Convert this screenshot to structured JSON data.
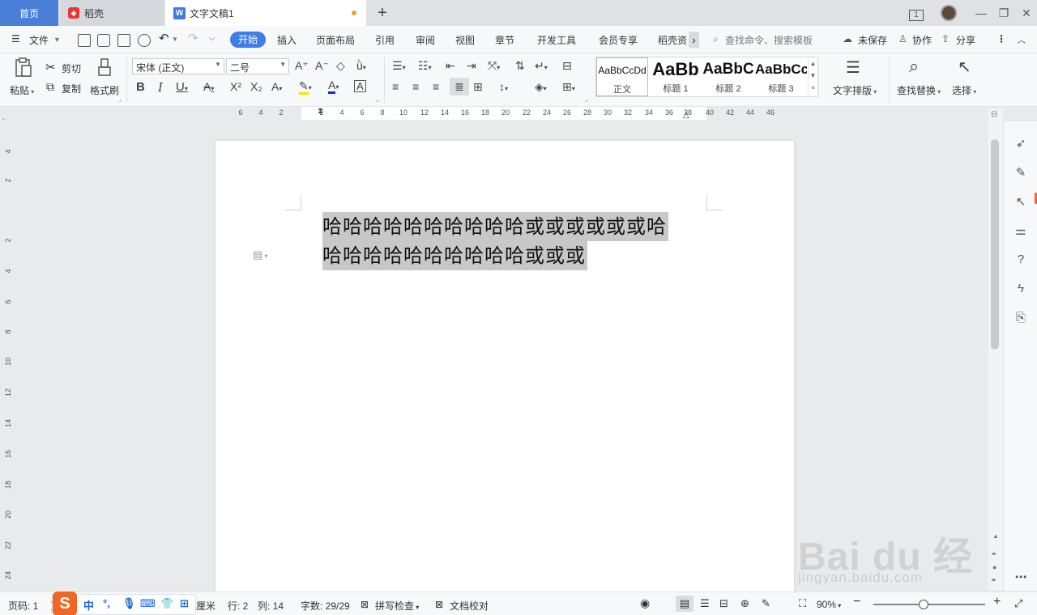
{
  "window": {
    "tabs": [
      {
        "label": "首页"
      },
      {
        "label": "稻壳"
      },
      {
        "label": "文字文稿1"
      }
    ],
    "add_tab": "+",
    "page_count_badge": "1"
  },
  "menu": {
    "file": "文件",
    "items": [
      "开始",
      "插入",
      "页面布局",
      "引用",
      "审阅",
      "视图",
      "章节",
      "开发工具",
      "会员专享",
      "稻壳资"
    ],
    "more": "›",
    "search_placeholder": "查找命令、搜索模板",
    "unsaved": "未保存",
    "collab": "协作",
    "share": "分享"
  },
  "ribbon": {
    "paste": "粘贴",
    "cut": "剪切",
    "copy": "复制",
    "format_painter": "格式刷",
    "font_name": "宋体 (正文)",
    "font_size": "二号",
    "styles": [
      {
        "preview": "AaBbCcDd",
        "label": "正文"
      },
      {
        "preview": "AaBb",
        "label": "标题 1"
      },
      {
        "preview": "AaBbC",
        "label": "标题 2"
      },
      {
        "preview": "AaBbCc",
        "label": "标题 3"
      }
    ],
    "text_layout": "文字排版",
    "find_replace": "查找替换",
    "select": "选择"
  },
  "ruler": {
    "h_marks": [
      "6",
      "4",
      "2",
      "2",
      "4",
      "6",
      "8",
      "10",
      "12",
      "14",
      "16",
      "18",
      "20",
      "22",
      "24",
      "26",
      "28",
      "30",
      "32",
      "34",
      "36",
      "38",
      "40",
      "42",
      "44",
      "46"
    ],
    "v_marks": [
      "4",
      "2",
      "2",
      "4",
      "6",
      "8",
      "10",
      "12",
      "14",
      "16",
      "18",
      "20",
      "22",
      "24"
    ]
  },
  "document": {
    "lines": [
      "哈哈哈哈哈哈哈哈哈哈或或或或或或哈",
      "哈哈哈哈哈哈哈哈哈哈或或或"
    ]
  },
  "status": {
    "page": "页码: 1",
    "page_cont": "页",
    "unit": "厘米",
    "row": "行: 2",
    "col": "列: 14",
    "word_count": "字数: 29/29",
    "spell_check": "拼写检查",
    "doc_proof": "文档校对",
    "zoom": "90%",
    "zoom_level": 0.45
  },
  "ime": {
    "logo": "S",
    "lang": "中"
  },
  "watermark": {
    "big": "Bai du 经验",
    "small": "jingyan.baidu.com"
  },
  "colors": {
    "accent": "#3f7ee8",
    "home_tab": "#4a7fd8",
    "selection": "#c8c8c8",
    "unsaved_dot": "#f0a020"
  }
}
